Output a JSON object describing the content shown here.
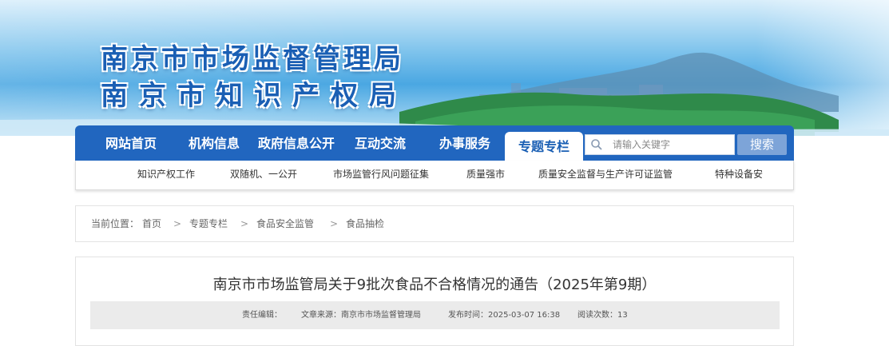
{
  "header": {
    "title_line1": "南京市市场监督管理局",
    "title_line2": "南京市知识产权局"
  },
  "nav": {
    "items": [
      {
        "label": "网站首页"
      },
      {
        "label": "机构信息"
      },
      {
        "label": "政府信息公开"
      },
      {
        "label": "互动交流"
      },
      {
        "label": "办事服务"
      },
      {
        "label": "专题专栏",
        "active": true
      }
    ],
    "search": {
      "placeholder": "请输入关键字",
      "value": "",
      "button_label": "搜索"
    }
  },
  "subnav": {
    "items": [
      {
        "label": "知识产权工作"
      },
      {
        "label": "双随机、一公开"
      },
      {
        "label": "市场监管行风问题征集"
      },
      {
        "label": "质量强市"
      },
      {
        "label": "质量安全监督与生产许可证监管"
      },
      {
        "label": "特种设备安"
      }
    ]
  },
  "breadcrumb": {
    "prefix": "当前位置：",
    "items": [
      "首页",
      "专题专栏",
      "食品安全监管",
      "食品抽检"
    ],
    "separator": ">"
  },
  "article": {
    "title": "南京市市场监管局关于9批次食品不合格情况的通告（2025年第9期）",
    "meta": {
      "editor": "责任编辑：",
      "source": "文章来源：南京市市场监督管理局",
      "published": "发布时间：2025-03-07 16:38",
      "views": "阅读次数：13"
    }
  },
  "colors": {
    "nav_bg": "#2166bf",
    "title_blue": "#1a5fb4",
    "search_button": "#7da4d8",
    "meta_bg": "#ebebeb"
  }
}
